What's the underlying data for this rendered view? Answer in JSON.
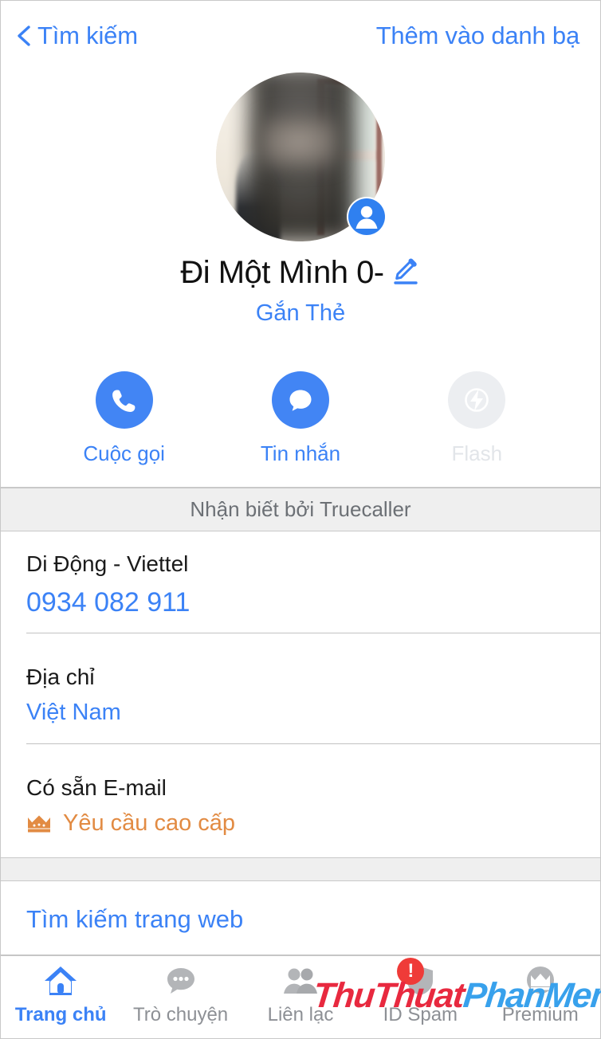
{
  "navbar": {
    "back_label": "Tìm kiếm",
    "back_icon": "chevron-left-icon",
    "action_label": "Thêm vào danh bạ"
  },
  "profile": {
    "avatar_alt": "blurred-profile-photo",
    "badge_icon": "person-badge-icon",
    "name": "Đi Một Mình 0-",
    "edit_icon": "pencil-edit-icon",
    "tag_link": "Gắn Thẻ"
  },
  "actions": [
    {
      "label": "Cuộc gọi",
      "icon": "phone-icon",
      "enabled": true
    },
    {
      "label": "Tin nhắn",
      "icon": "message-bubble-icon",
      "enabled": true
    },
    {
      "label": "Flash",
      "icon": "flash-bolt-icon",
      "enabled": false
    }
  ],
  "identified_band": "Nhận biết bởi Truecaller",
  "info": [
    {
      "label": "Di Động - Viettel",
      "value": "0934 082 911",
      "size": "large"
    },
    {
      "label": "Địa chỉ",
      "value": "Việt Nam",
      "size": "small"
    },
    {
      "label": "Có sẵn E-mail",
      "value": "Yêu cầu cao cấp",
      "icon": "crown-icon",
      "size": "premium"
    }
  ],
  "web_search": {
    "label": "Tìm kiếm trang web"
  },
  "tabs": [
    {
      "label": "Trang chủ",
      "icon": "home-icon",
      "active": true,
      "badge": ""
    },
    {
      "label": "Trò chuyện",
      "icon": "chat-bubble-icon",
      "active": false,
      "badge": ""
    },
    {
      "label": "Liên lạc",
      "icon": "contacts-icon",
      "active": false,
      "badge": ""
    },
    {
      "label": "ID Spam",
      "icon": "shield-icon",
      "active": false,
      "badge": "!"
    },
    {
      "label": "Premium",
      "icon": "premium-crown-icon",
      "active": false,
      "badge": ""
    }
  ],
  "watermark": {
    "part1": "ThuThuat",
    "part2": "PhanMem.vn"
  },
  "colors": {
    "accent_blue": "#3b82f6",
    "button_blue": "#4285f4",
    "premium_orange": "#e28b43",
    "badge_red": "#ef3b38",
    "band_gray": "#efefef",
    "muted_gray": "#8d9095"
  }
}
